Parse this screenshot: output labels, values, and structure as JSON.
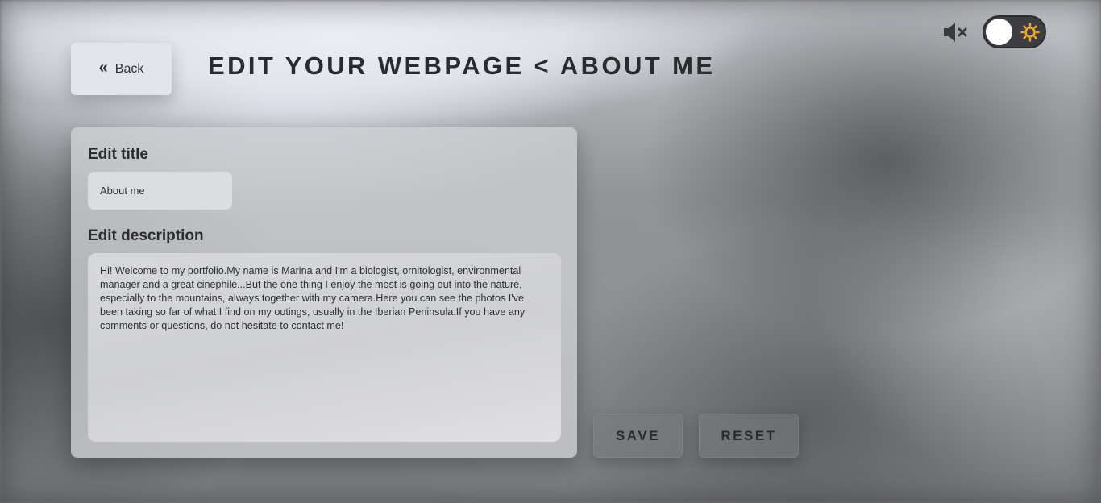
{
  "header": {
    "back_label": "Back",
    "back_icon": "«",
    "title": "EDIT YOUR WEBPAGE < ABOUT ME"
  },
  "controls": {
    "mute_icon": "speaker-muted-icon",
    "theme_icon": "sun-icon",
    "theme_accent": "#f5a623"
  },
  "form": {
    "title_label": "Edit title",
    "title_value": "About me",
    "description_label": "Edit description",
    "description_value": "Hi! Welcome to my portfolio.My name is Marina and I'm a biologist, ornitologist, environmental manager and a great cinephile...But the one thing I enjoy the most is going out into the nature, especially to the mountains, always together with my camera.Here you can see the photos I've been taking so far of what I find on my outings, usually in the Iberian Peninsula.If you have any comments or questions, do not hesitate to contact me!"
  },
  "actions": {
    "save_label": "SAVE",
    "reset_label": "RESET"
  }
}
